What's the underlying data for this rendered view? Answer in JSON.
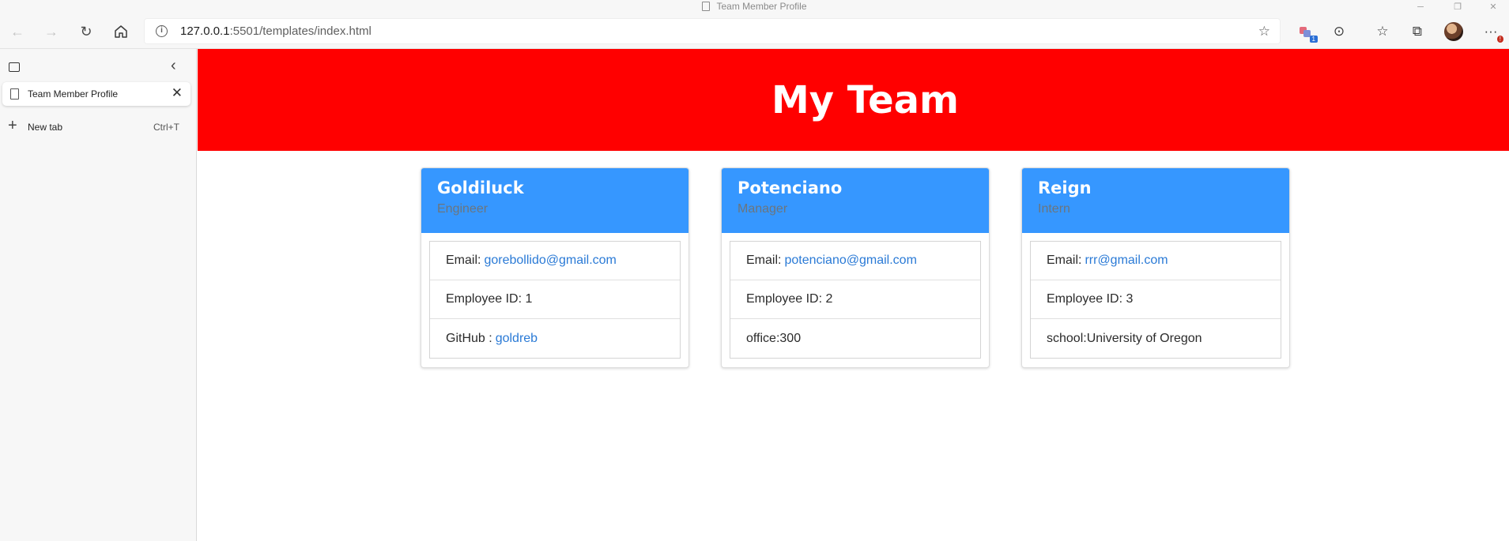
{
  "window": {
    "title": "Team Member Profile",
    "controls": {
      "minimize": "─",
      "restore": "❐",
      "close": "✕"
    }
  },
  "toolbar": {
    "url_host": "127.0.0.1",
    "url_rest": ":5501/templates/index.html",
    "extension_badge": "1",
    "menu_badge": "!"
  },
  "sidebar": {
    "tabs": [
      {
        "label": "Team Member Profile"
      }
    ],
    "new_tab_label": "New tab",
    "new_tab_shortcut": "Ctrl+T"
  },
  "page": {
    "heading": "My Team",
    "team": [
      {
        "name": "Goldiluck",
        "role": "Engineer",
        "email_label": "Email:",
        "email": "gorebollido@gmail.com",
        "id_text": "Employee ID: 1",
        "extra_label": "GitHub :",
        "extra_value": "goldreb"
      },
      {
        "name": "Potenciano",
        "role": "Manager",
        "email_label": "Email:",
        "email": "potenciano@gmail.com",
        "id_text": "Employee ID: 2",
        "extra_text": "office:300"
      },
      {
        "name": "Reign",
        "role": "Intern",
        "email_label": "Email:",
        "email": "rrr@gmail.com",
        "id_text": "Employee ID: 3",
        "extra_text": "school:University of Oregon"
      }
    ]
  },
  "colors": {
    "header_bg": "#ff0000",
    "card_header_bg": "#3697ff",
    "link": "#2a7ad6",
    "role_text": "#6c757d"
  }
}
